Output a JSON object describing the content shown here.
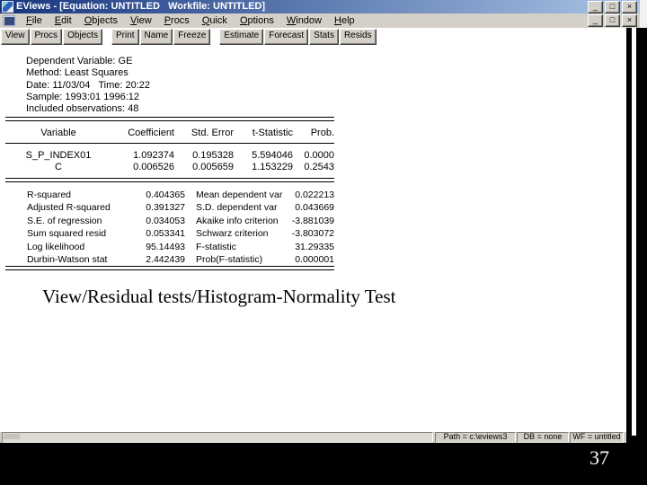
{
  "window": {
    "title": "EViews - [Equation: UNTITLED   Workfile: UNTITLED]",
    "menus": [
      "File",
      "Edit",
      "Objects",
      "View",
      "Procs",
      "Quick",
      "Options",
      "Window",
      "Help"
    ],
    "toolbar_groups": [
      [
        "View",
        "Procs",
        "Objects"
      ],
      [
        "Print",
        "Name",
        "Freeze"
      ],
      [
        "Estimate",
        "Forecast",
        "Stats",
        "Resids"
      ]
    ],
    "controls": {
      "minimize": "_",
      "restore": "□",
      "close": "×"
    }
  },
  "output": {
    "header_lines": [
      "Dependent Variable: GE",
      "Method: Least Squares",
      "Date: 11/03/04   Time: 20:22",
      "Sample: 1993:01 1996:12",
      "Included observations: 48"
    ],
    "coef_table": {
      "columns": [
        "Variable",
        "Coefficient",
        "Std. Error",
        "t-Statistic",
        "Prob."
      ],
      "rows": [
        {
          "variable": "S_P_INDEX01",
          "coefficient": "1.092374",
          "std_error": "0.195328",
          "t_statistic": "5.594046",
          "prob": "0.0000"
        },
        {
          "variable": "C",
          "coefficient": "0.006526",
          "std_error": "0.005659",
          "t_statistic": "1.153229",
          "prob": "0.2543"
        }
      ]
    },
    "stats": [
      {
        "left_label": "R-squared",
        "left_value": "0.404365",
        "right_label": "Mean dependent var",
        "right_value": "0.022213"
      },
      {
        "left_label": "Adjusted R-squared",
        "left_value": "0.391327",
        "right_label": "S.D. dependent var",
        "right_value": "0.043669"
      },
      {
        "left_label": "S.E. of regression",
        "left_value": "0.034053",
        "right_label": "Akaike info criterion",
        "right_value": "-3.881039"
      },
      {
        "left_label": "Sum squared resid",
        "left_value": "0.053341",
        "right_label": "Schwarz criterion",
        "right_value": "-3.803072"
      },
      {
        "left_label": "Log likelihood",
        "left_value": "95.14493",
        "right_label": "F-statistic",
        "right_value": "31.29335"
      },
      {
        "left_label": "Durbin-Watson stat",
        "left_value": "2.442439",
        "right_label": "Prob(F-statistic)",
        "right_value": "0.000001"
      }
    ]
  },
  "slide": {
    "caption": "View/Residual tests/Histogram-Normality Test",
    "page_number": "37"
  },
  "statusbar": {
    "panels": [
      "Path = c:\\eviews3",
      "DB = none",
      "WF = untitled"
    ]
  },
  "colors": {
    "titlebar_gradient_start": "#16357e",
    "titlebar_gradient_end": "#a9c5e6",
    "chrome_gray": "#d4d0c8",
    "slide_background": "#000000",
    "client_background": "#ffffff",
    "text": "#000000",
    "title_text": "#ffffff"
  }
}
